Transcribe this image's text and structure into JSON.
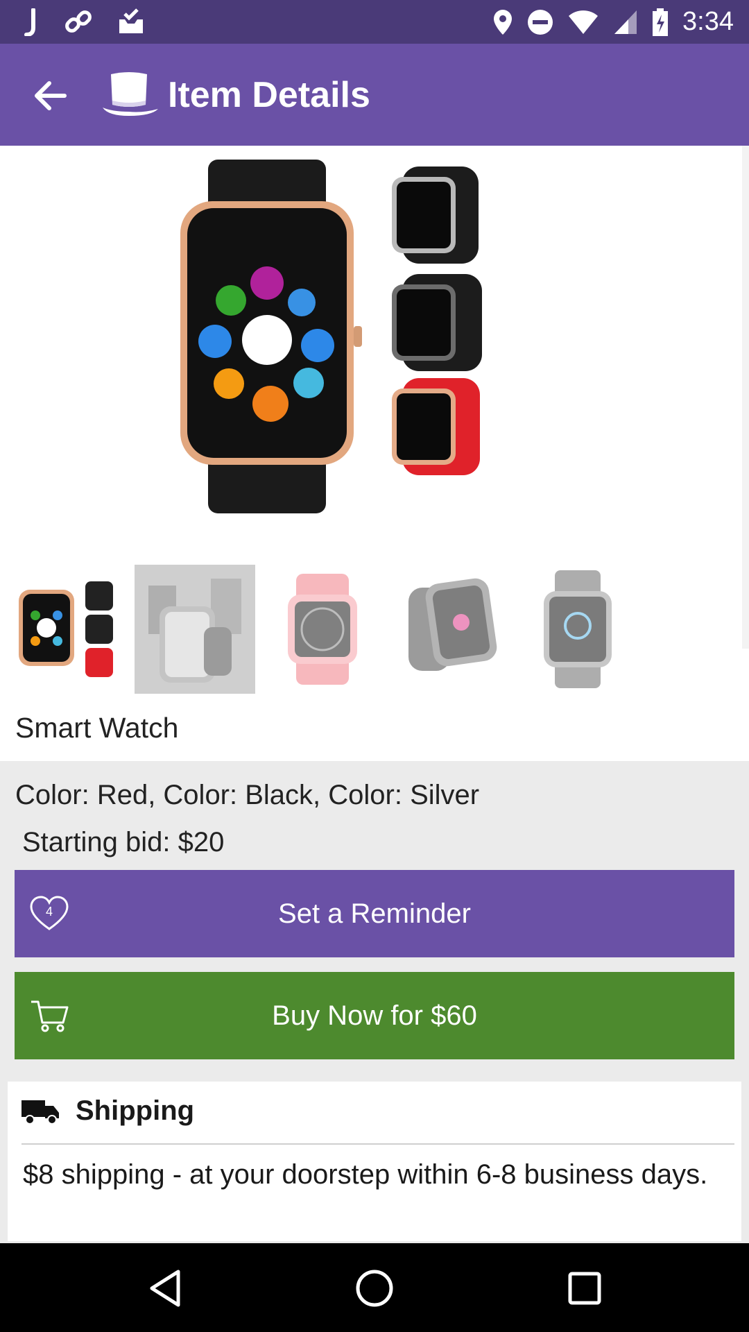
{
  "status_bar": {
    "time": "3:34",
    "left_icons": [
      "j-app-icon",
      "link-icon",
      "inbox-check-icon"
    ],
    "right_icons": [
      "location-icon",
      "do-not-disturb-icon",
      "wifi-icon",
      "signal-icon",
      "battery-charging-icon"
    ]
  },
  "app_bar": {
    "title": "Item Details",
    "back_icon": "arrow-back-icon",
    "logo_icon": "top-hat-icon"
  },
  "product": {
    "name": "Smart Watch",
    "thumbnails": [
      {
        "label": "watch-variants",
        "selected": true
      },
      {
        "label": "watch-phones",
        "selected": false
      },
      {
        "label": "watch-pink",
        "selected": false
      },
      {
        "label": "watch-angled",
        "selected": false
      },
      {
        "label": "watch-silver",
        "selected": false
      }
    ]
  },
  "details": {
    "color_line": "Color: Red, Color: Black, Color: Silver",
    "starting_bid": "Starting bid: $20"
  },
  "actions": {
    "reminder_label": "Set a Reminder",
    "reminder_count": "4",
    "buy_label": "Buy Now for $60"
  },
  "shipping": {
    "title": "Shipping",
    "text": "$8 shipping - at your doorstep within 6-8 business days."
  },
  "colors": {
    "status_bar": "#4a3a78",
    "primary": "#6a51a6",
    "buy_green": "#4d8a2e",
    "background": "#ebebeb"
  }
}
